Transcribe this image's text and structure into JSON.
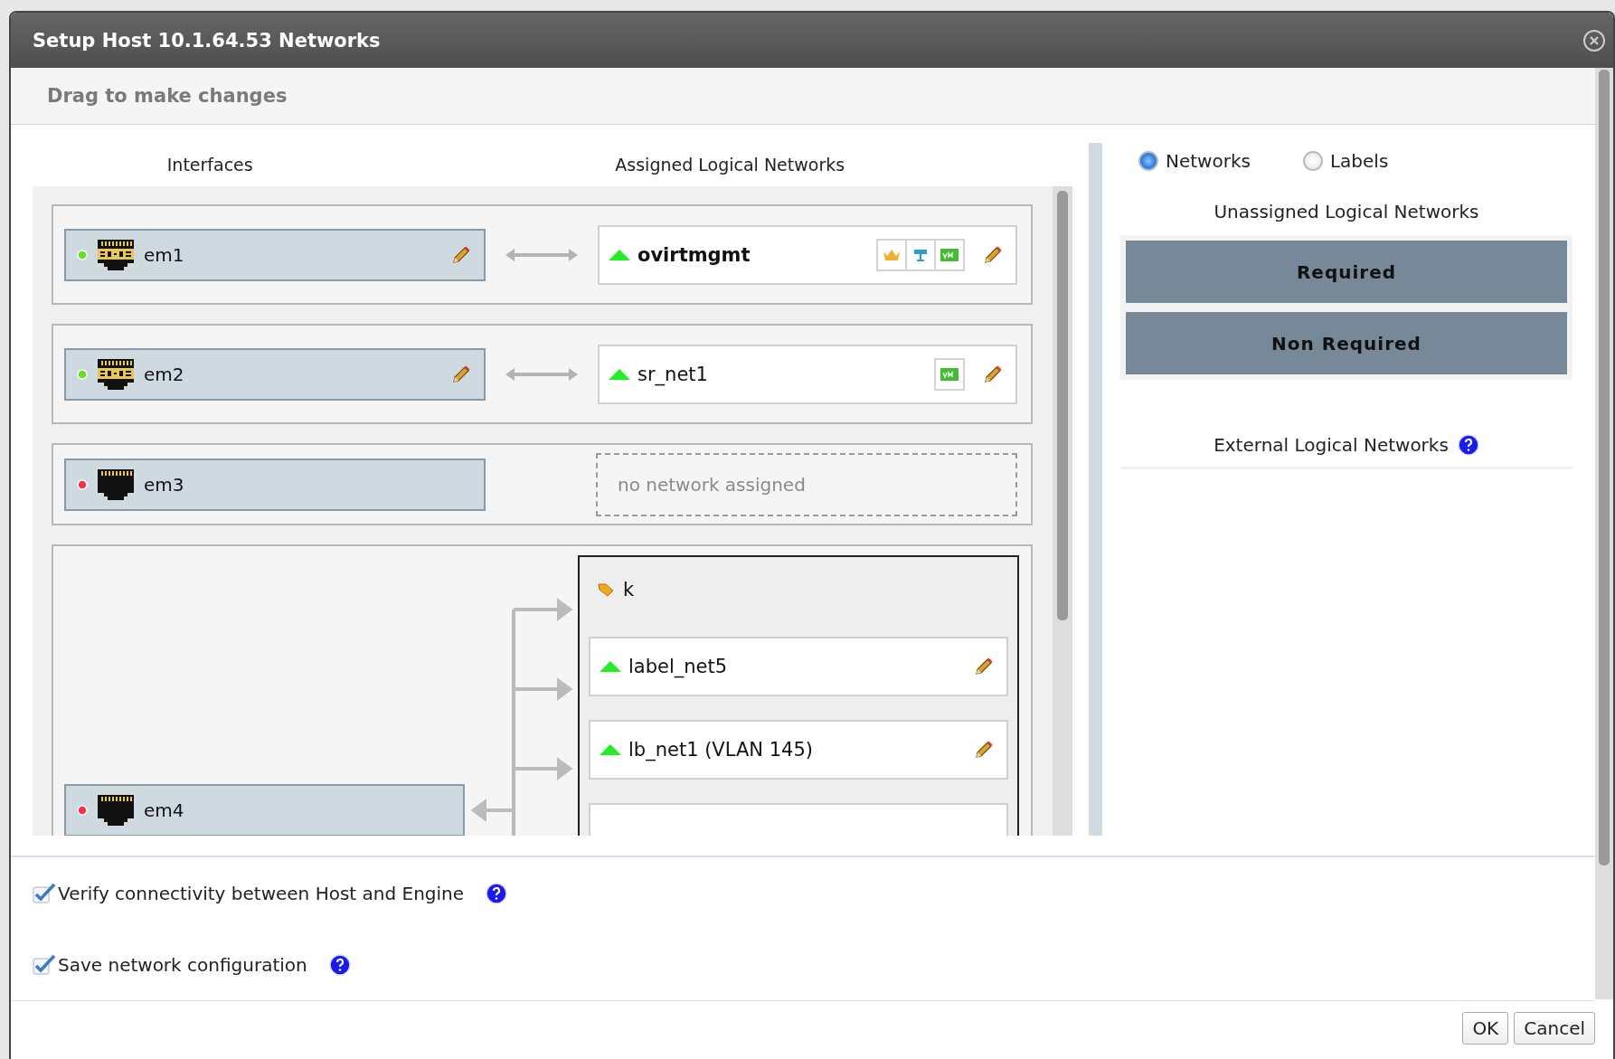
{
  "window": {
    "title": "Setup Host 10.1.64.53 Networks"
  },
  "hint": "Drag to make changes",
  "columns": [
    "Interfaces",
    "Assigned Logical Networks"
  ],
  "interfaces": [
    {
      "name": "em1",
      "up": true,
      "sriov": true,
      "editable": true,
      "networks": [
        {
          "name": "ovirtmgmt",
          "up": true,
          "management": true,
          "display": true,
          "vm": true,
          "editable": true
        }
      ]
    },
    {
      "name": "em2",
      "up": true,
      "sriov": true,
      "editable": true,
      "networks": [
        {
          "name": "sr_net1",
          "up": true,
          "management": false,
          "display": false,
          "vm": true,
          "editable": true
        }
      ]
    },
    {
      "name": "em3",
      "up": false,
      "sriov": false,
      "editable": false,
      "placeholder": "no network assigned"
    },
    {
      "name": "em4",
      "up": false,
      "sriov": false,
      "editable": false,
      "label": {
        "name": "k",
        "more": true,
        "networks": [
          {
            "name": "label_net5",
            "up": true,
            "management": false,
            "display": false,
            "vm": false,
            "editable": true
          },
          {
            "name": "lb_net1 (VLAN 145)",
            "up": true,
            "management": false,
            "display": false,
            "vm": false,
            "editable": true
          }
        ]
      }
    }
  ],
  "view": [
    {
      "label": "Networks",
      "selected": true
    },
    {
      "label": "Labels",
      "selected": false
    }
  ],
  "unassigned": {
    "title": "Unassigned Logical Networks",
    "buckets": [
      "Required",
      "Non Required"
    ]
  },
  "external": {
    "title": "External Logical Networks"
  },
  "options": [
    {
      "label": "Verify connectivity between Host and Engine",
      "checked": true
    },
    {
      "label": "Save network configuration",
      "checked": true
    }
  ],
  "buttons": [
    "OK",
    "Cancel"
  ]
}
